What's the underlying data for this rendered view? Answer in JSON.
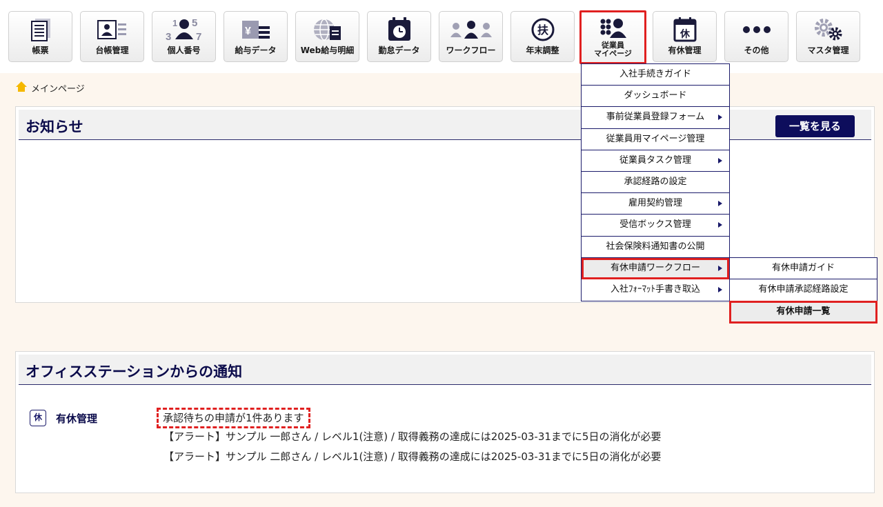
{
  "toolbar": {
    "buttons": [
      {
        "label": "帳票",
        "icon": "document-icon"
      },
      {
        "label": "台帳管理",
        "icon": "ledger-icon"
      },
      {
        "label": "個人番号",
        "icon": "person-number-icon"
      },
      {
        "label": "給与データ",
        "icon": "salary-data-icon"
      },
      {
        "label": "Web給与明細",
        "icon": "web-payslip-icon"
      },
      {
        "label": "勤怠データ",
        "icon": "attendance-clock-icon"
      },
      {
        "label": "ワークフロー",
        "icon": "workflow-people-icon"
      },
      {
        "label": "年末調整",
        "icon": "year-end-adjustment-icon",
        "glyph": "扶"
      },
      {
        "label_line1": "従業員",
        "label_line2": "マイページ",
        "icon": "employee-mypage-icon"
      },
      {
        "label": "有休管理",
        "icon": "paid-leave-calendar-icon",
        "glyph": "休"
      },
      {
        "label": "その他",
        "icon": "more-dots-icon"
      },
      {
        "label": "マスタ管理",
        "icon": "gears-icon"
      }
    ]
  },
  "breadcrumb": {
    "label": "メインページ",
    "icon": "home-icon"
  },
  "news_panel": {
    "title": "お知らせ",
    "list_button": "一覧を見る"
  },
  "office_panel": {
    "title": "オフィスステーションからの通知",
    "row": {
      "badge": "休",
      "label": "有休管理",
      "lines": [
        "承認待ちの申請が1件あります",
        "【アラート】サンプル 一郎さん / レベル1(注意) / 取得義務の達成には2025-03-31までに5日の消化が必要",
        "【アラート】サンプル 二郎さん / レベル1(注意) / 取得義務の達成には2025-03-31までに5日の消化が必要"
      ]
    }
  },
  "menu": {
    "items": [
      {
        "label": "入社手続きガイド",
        "submenu": false
      },
      {
        "label": "ダッシュボード",
        "submenu": false
      },
      {
        "label": "事前従業員登録フォーム",
        "submenu": true
      },
      {
        "label": "従業員用マイページ管理",
        "submenu": false
      },
      {
        "label": "従業員タスク管理",
        "submenu": true
      },
      {
        "label": "承認経路の設定",
        "submenu": false
      },
      {
        "label": "雇用契約管理",
        "submenu": true
      },
      {
        "label": "受信ボックス管理",
        "submenu": true
      },
      {
        "label": "社会保険料通知書の公開",
        "submenu": false
      },
      {
        "label": "有休申請ワークフロー",
        "submenu": true
      },
      {
        "label": "入社ﾌｫｰﾏｯﾄ手書き取込",
        "submenu": true
      }
    ],
    "submenu": [
      {
        "label": "有休申請ガイド"
      },
      {
        "label": "有休申請承認経路設定"
      },
      {
        "label": "有休申請一覧"
      }
    ]
  },
  "colors": {
    "accent_red": "#e02020",
    "navy": "#0d0d5c",
    "background": "#fdf6ee"
  }
}
